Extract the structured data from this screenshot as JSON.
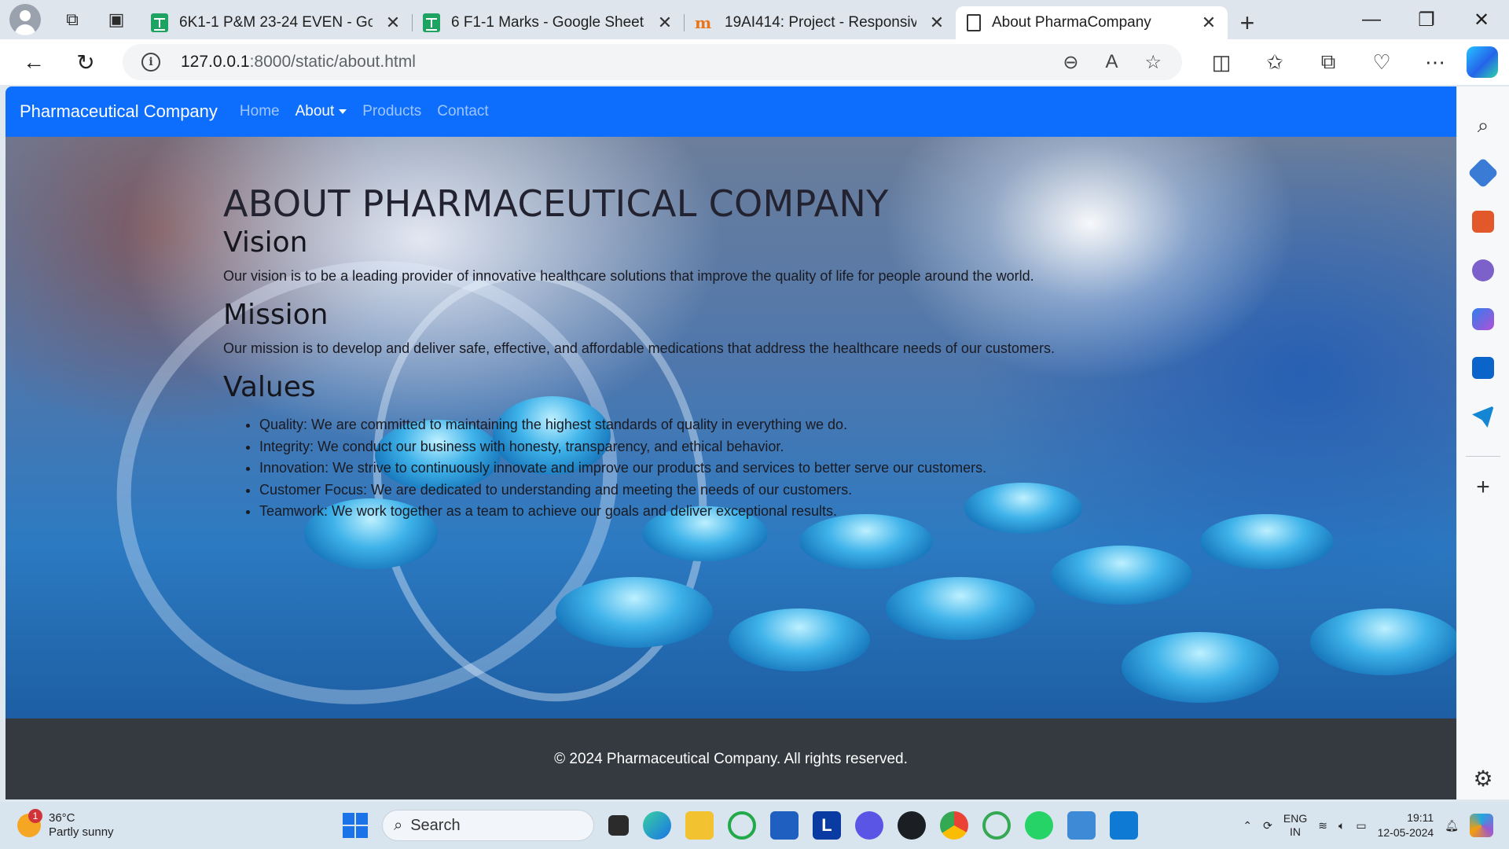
{
  "browser": {
    "tabs": [
      {
        "title": "6K1-1 P&M 23-24 EVEN - Goo",
        "favicon": "sheets-icon",
        "active": false
      },
      {
        "title": "6 F1-1 Marks - Google Sheets",
        "favicon": "sheets-icon",
        "active": false
      },
      {
        "title": "19AI414: Project - Responsive",
        "favicon": "moodle-icon",
        "active": false
      },
      {
        "title": "About PharmaCompany",
        "favicon": "page-icon",
        "active": true
      }
    ],
    "url_host": "127.0.0.1",
    "url_path": ":8000/static/about.html"
  },
  "page": {
    "brand": "Pharmaceutical Company",
    "nav": {
      "home": "Home",
      "about": "About",
      "products": "Products",
      "contact": "Contact"
    },
    "heading": "ABOUT PHARMACEUTICAL COMPANY",
    "vision": {
      "title": "Vision",
      "text": "Our vision is to be a leading provider of innovative healthcare solutions that improve the quality of life for people around the world."
    },
    "mission": {
      "title": "Mission",
      "text": "Our mission is to develop and deliver safe, effective, and affordable medications that address the healthcare needs of our customers."
    },
    "values": {
      "title": "Values",
      "items": [
        "Quality: We are committed to maintaining the highest standards of quality in everything we do.",
        "Integrity: We conduct our business with honesty, transparency, and ethical behavior.",
        "Innovation: We strive to continuously innovate and improve our products and services to better serve our customers.",
        "Customer Focus: We are dedicated to understanding and meeting the needs of our customers.",
        "Teamwork: We work together as a team to achieve our goals and deliver exceptional results."
      ]
    },
    "footer": "© 2024 Pharmaceutical Company. All rights reserved."
  },
  "taskbar": {
    "weather_temp": "36°C",
    "weather_desc": "Partly sunny",
    "weather_badge": "1",
    "search_placeholder": "Search",
    "lang_top": "ENG",
    "lang_bottom": "IN",
    "time": "19:11",
    "date": "12-05-2024"
  },
  "colors": {
    "navbar": "#0d6efd",
    "footer": "#343a40"
  }
}
